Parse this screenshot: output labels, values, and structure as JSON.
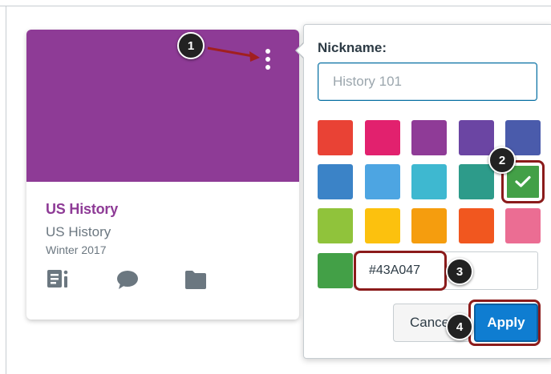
{
  "course_card": {
    "hero_color": "#8E3B96",
    "title": "US History",
    "title_color": "#8E3B96",
    "subtitle": "US History",
    "term": "Winter 2017",
    "options_icon": "kebab-vertical-icon",
    "action_icons": [
      "announcements-icon",
      "discussions-icon",
      "files-icon"
    ],
    "icon_color": "#6b7780"
  },
  "popover": {
    "nickname_label": "Nickname:",
    "nickname_placeholder": "History 101",
    "swatches": [
      "#E94235",
      "#E2216E",
      "#8F3B97",
      "#6B45A3",
      "#4A5BAB",
      "#3B83C7",
      "#4DA5E2",
      "#3EB8D0",
      "#2D9B8A",
      "#43A047",
      "#90C33B",
      "#FCC10E",
      "#F59D0E",
      "#F1571F",
      "#EB6D93"
    ],
    "selected_swatch_index": 9,
    "selected_color": "#43A047",
    "hex_value": "#43A047",
    "cancel_label": "Cancel",
    "apply_label": "Apply"
  },
  "callouts": [
    "1",
    "2",
    "3",
    "4"
  ],
  "colors": {
    "accent": "#0f7dd1",
    "callout_bg": "#222222",
    "highlight": "#8b1b1b"
  }
}
